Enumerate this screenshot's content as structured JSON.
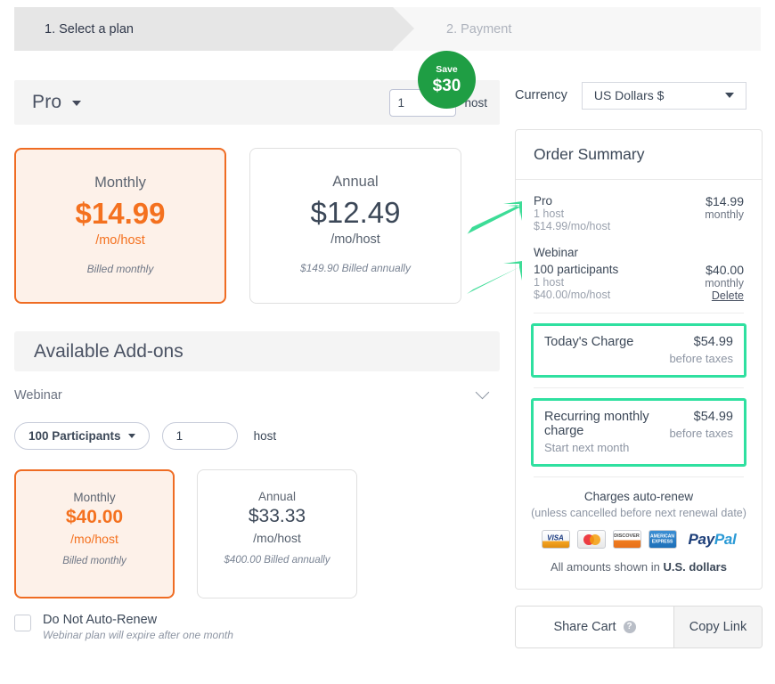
{
  "steps": [
    {
      "label": "1. Select a plan",
      "state": "active"
    },
    {
      "label": "2. Payment",
      "state": "inactive"
    }
  ],
  "plan_bar": {
    "plan_name": "Pro",
    "quantity": "1",
    "host_label": "host"
  },
  "currency": {
    "label": "Currency",
    "value": "US Dollars $"
  },
  "plan_cards": [
    {
      "title": "Monthly",
      "price": "$14.99",
      "per": "/mo/host",
      "note": "Billed monthly",
      "selected": true
    },
    {
      "title": "Annual",
      "price": "$12.49",
      "per": "/mo/host",
      "note": "$149.90 Billed annually",
      "selected": false
    }
  ],
  "save_badge": {
    "line1": "Save",
    "line2": "$30"
  },
  "addons": {
    "header": "Available Add-ons",
    "name": "Webinar",
    "participants_select": "100 Participants",
    "quantity": "1",
    "host_label": "host",
    "cards": [
      {
        "title": "Monthly",
        "price": "$40.00",
        "per": "/mo/host",
        "note": "Billed monthly",
        "selected": true
      },
      {
        "title": "Annual",
        "price": "$33.33",
        "per": "/mo/host",
        "note": "$400.00 Billed annually",
        "selected": false
      }
    ],
    "no_renew_title": "Do Not Auto-Renew",
    "no_renew_sub": "Webinar plan will expire after one month"
  },
  "order_summary": {
    "title": "Order Summary",
    "items": [
      {
        "name": "Pro",
        "hosts": "1 host",
        "unit": "$14.99/mo/host",
        "price": "$14.99",
        "cycle": "monthly"
      }
    ],
    "addon_item": {
      "group": "Webinar",
      "name": "100 participants",
      "hosts": "1 host",
      "unit": "$40.00/mo/host",
      "price": "$40.00",
      "cycle": "monthly",
      "delete_label": "Delete"
    },
    "today": {
      "label": "Today's Charge",
      "price": "$54.99",
      "note": "before taxes"
    },
    "recurring": {
      "label": "Recurring monthly charge",
      "sub": "Start next month",
      "price": "$54.99",
      "note": "before taxes"
    },
    "footer": {
      "auto_renew": "Charges auto-renew",
      "auto_renew_sub": "(unless cancelled before next renewal date)",
      "payment_methods": [
        "VISA",
        "MasterCard",
        "DISCOVER",
        "AMERICAN EXPRESS",
        "PayPal"
      ],
      "amounts_prefix": "All amounts shown in ",
      "amounts_currency": "U.S. dollars"
    }
  },
  "share": {
    "share_cart": "Share Cart",
    "copy_link": "Copy Link"
  },
  "colors": {
    "accent_orange": "#ef6c23",
    "highlight_green": "#2fe0a0",
    "badge_green": "#1f9e44",
    "arrow_green": "#3ddc97"
  }
}
